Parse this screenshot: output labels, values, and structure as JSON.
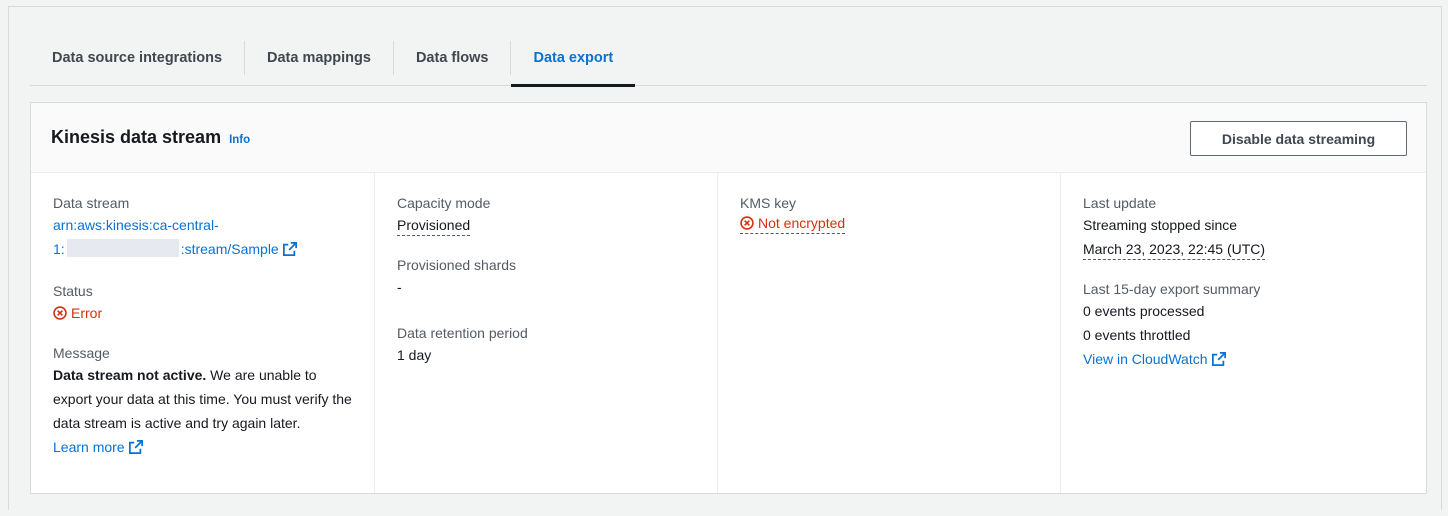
{
  "tabs": [
    {
      "label": "Data source integrations",
      "active": false
    },
    {
      "label": "Data mappings",
      "active": false
    },
    {
      "label": "Data flows",
      "active": false
    },
    {
      "label": "Data export",
      "active": true
    }
  ],
  "panel": {
    "title": "Kinesis data stream",
    "info_label": "Info",
    "disable_button": "Disable data streaming"
  },
  "col1": {
    "data_stream_label": "Data stream",
    "stream_arn_line1": "arn:aws:kinesis:ca-central-",
    "stream_arn_prefix": "1:",
    "stream_arn_suffix": ":stream/Sample",
    "status_label": "Status",
    "status_value": "Error",
    "message_label": "Message",
    "message_bold": "Data stream not active.",
    "message_text": " We are unable to export your data at this time. You must verify the data stream is active and try again later.",
    "learn_more": "Learn more"
  },
  "col2": {
    "capacity_label": "Capacity mode",
    "capacity_value": "Provisioned",
    "shards_label": "Provisioned shards",
    "shards_value": "-",
    "retention_label": "Data retention period",
    "retention_value": "1 day"
  },
  "col3": {
    "kms_label": "KMS key",
    "kms_value": "Not encrypted"
  },
  "col4": {
    "last_update_label": "Last update",
    "last_update_line1": "Streaming stopped since",
    "last_update_line2": "March 23, 2023, 22:45 (UTC)",
    "summary_label": "Last 15-day export summary",
    "events_processed": "0 events processed",
    "events_throttled": "0 events throttled",
    "cloudwatch_link": "View in CloudWatch"
  },
  "colors": {
    "link": "#0972d3",
    "error": "#d13212",
    "text": "#16191f",
    "label": "#545b64"
  },
  "icons": [
    "external-link-icon",
    "error-status-icon"
  ]
}
